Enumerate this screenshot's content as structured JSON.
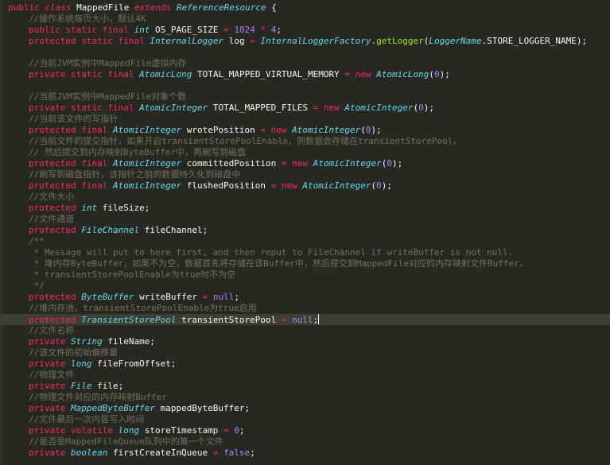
{
  "code": {
    "l01": {
      "kw_public": "public",
      "kw_class": "class",
      "name": "MappedFile",
      "kw_extends": "extends",
      "parent": "ReferenceResource",
      "brace": "{"
    },
    "l02": {
      "comment": "//操作系统每页大小，默认4K"
    },
    "l03": {
      "m1": "public",
      "m2": "static",
      "m3": "final",
      "type": "int",
      "name": "OS_PAGE_SIZE",
      "op": "=",
      "n1": "1024",
      "times": "*",
      "n2": "4",
      "end": ";"
    },
    "l04": {
      "m1": "protected",
      "m2": "static",
      "m3": "final",
      "type": "InternalLogger",
      "name": "log",
      "op": "=",
      "factory": "InternalLoggerFactory",
      "dot": ".",
      "method": "getLogger",
      "paren_open": "(",
      "cls": "LoggerName",
      "dot2": ".",
      "const": "STORE_LOGGER_NAME",
      "paren_close": ");"
    },
    "l06": {
      "comment": "//当前JVM实例中MappedFile虚拟内存"
    },
    "l07": {
      "m1": "private",
      "m2": "static",
      "m3": "final",
      "type": "AtomicLong",
      "name": "TOTAL_MAPPED_VIRTUAL_MEMORY",
      "op": "=",
      "kw_new": "new",
      "ctor": "AtomicLong",
      "paren_open": "(",
      "arg": "0",
      "paren_close": ");"
    },
    "l09": {
      "comment": "//当前JVM实例中MappedFile对象个数"
    },
    "l10": {
      "m1": "private",
      "m2": "static",
      "m3": "final",
      "type": "AtomicInteger",
      "name": "TOTAL_MAPPED_FILES",
      "op": "=",
      "kw_new": "new",
      "ctor": "AtomicInteger",
      "paren_open": "(",
      "arg": "0",
      "paren_close": ");"
    },
    "l11": {
      "comment": "//当前该文件的写指针"
    },
    "l12": {
      "m1": "protected",
      "m2": "final",
      "type": "AtomicInteger",
      "name": "wrotePosition",
      "op": "=",
      "kw_new": "new",
      "ctor": "AtomicInteger",
      "paren_open": "(",
      "arg": "0",
      "paren_close": ");"
    },
    "l13": {
      "comment": "//当前文件的提交指针，如果开启transientStorePoolEnable，则数据会存储在transientStorePool，"
    },
    "l14": {
      "comment": "// 然后提交到内存映射ByteBuffer中，再刷写到磁盘"
    },
    "l15": {
      "m1": "protected",
      "m2": "final",
      "type": "AtomicInteger",
      "name": "committedPosition",
      "op": "=",
      "kw_new": "new",
      "ctor": "AtomicInteger",
      "paren_open": "(",
      "arg": "0",
      "paren_close": ");"
    },
    "l16": {
      "comment": "//刷写到磁盘指针，该指针之前的数据持久化到磁盘中"
    },
    "l17": {
      "m1": "protected",
      "m2": "final",
      "type": "AtomicInteger",
      "name": "flushedPosition",
      "op": "=",
      "kw_new": "new",
      "ctor": "AtomicInteger",
      "paren_open": "(",
      "arg": "0",
      "paren_close": ");"
    },
    "l18": {
      "comment": "//文件大小"
    },
    "l19": {
      "m1": "protected",
      "type": "int",
      "name": "fileSize",
      "end": ";"
    },
    "l20": {
      "comment": "//文件通道"
    },
    "l21": {
      "m1": "protected",
      "type": "FileChannel",
      "name": "fileChannel",
      "end": ";"
    },
    "l22": {
      "comment": "/**"
    },
    "l23": {
      "comment": " * Message will put to here first, and then reput to FileChannel if writeBuffer is not null."
    },
    "l24": {
      "comment": " * 堆内存ByteBuffer，如果不为空，数据首先将存储在该Buffer中，然后提交到MappedFile对应的内存映射文件Buffer。"
    },
    "l25": {
      "comment": " * transientStorePoolEnable为true时不为空"
    },
    "l26": {
      "comment": " */"
    },
    "l27": {
      "m1": "protected",
      "type": "ByteBuffer",
      "name": "writeBuffer",
      "op": "=",
      "val": "null",
      "end": ";"
    },
    "l28": {
      "comment": "//堆内存池，transientStorePoolEnable为true启用"
    },
    "l29": {
      "m1": "protected",
      "type": "TransientStorePool",
      "name": "transientStorePool",
      "op": "=",
      "val": "null",
      "end": ";"
    },
    "l30": {
      "comment": "//文件名称"
    },
    "l31": {
      "m1": "private",
      "type": "String",
      "name": "fileName",
      "end": ";"
    },
    "l32": {
      "comment": "//该文件的初始偏移量"
    },
    "l33": {
      "m1": "private",
      "type": "long",
      "name": "fileFromOffset",
      "end": ";"
    },
    "l34": {
      "comment": "//物理文件"
    },
    "l35": {
      "m1": "private",
      "type": "File",
      "name": "file",
      "end": ";"
    },
    "l36": {
      "comment": "//物理文件对应的内存映射Buffer"
    },
    "l37": {
      "m1": "private",
      "type": "MappedByteBuffer",
      "name": "mappedByteBuffer",
      "end": ";"
    },
    "l38": {
      "comment": "//文件最后一次内容写入时间"
    },
    "l39": {
      "m1": "private",
      "m2": "volatile",
      "type": "long",
      "name": "storeTimestamp",
      "op": "=",
      "val": "0",
      "end": ";"
    },
    "l40": {
      "comment": "//是否是MappedFileQueue队列中的第一个文件"
    },
    "l41": {
      "m1": "private",
      "type": "boolean",
      "name": "firstCreateInQueue",
      "op": "=",
      "val": "false",
      "end": ";"
    }
  },
  "colors": {
    "background": "#272822",
    "keyword": "#F92672",
    "type": "#66D9EF",
    "number": "#AE81FF",
    "comment": "#75715E",
    "function": "#A6E22E",
    "text": "#F8F8F2"
  }
}
